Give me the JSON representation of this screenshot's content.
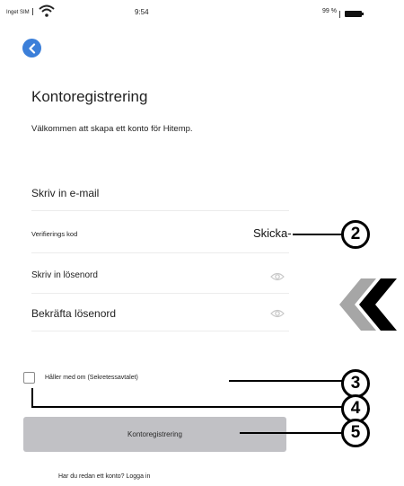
{
  "status_bar": {
    "carrier": "Inget SIM",
    "time": "9:54",
    "battery": "99 %"
  },
  "header": {
    "title": "Kontoregistrering",
    "welcome": "Välkommen att skapa ett konto för Hitemp."
  },
  "form": {
    "email_placeholder": "Skriv in e-mail",
    "verification_placeholder": "Verifierings kod",
    "send_label": "Skicka-",
    "password_placeholder": "Skriv in lösenord",
    "confirm_placeholder": "Bekräfta lösenord"
  },
  "agreement": {
    "text": "Håller med om (Sekretessavtalet)",
    "checked": false
  },
  "register_button": "Kontoregistrering",
  "login_prompt": "Har du redan ett konto? Logga in",
  "callouts": [
    "2",
    "3",
    "4",
    "5"
  ],
  "icons": {
    "back": "chevron-left-icon",
    "eye": "eye-icon",
    "wifi": "wifi-icon",
    "battery": "battery-icon",
    "arrow": "double-chevron-left-icon"
  },
  "colors": {
    "back_button": "#3b7fd9",
    "register_button": "#c1c1c5"
  }
}
